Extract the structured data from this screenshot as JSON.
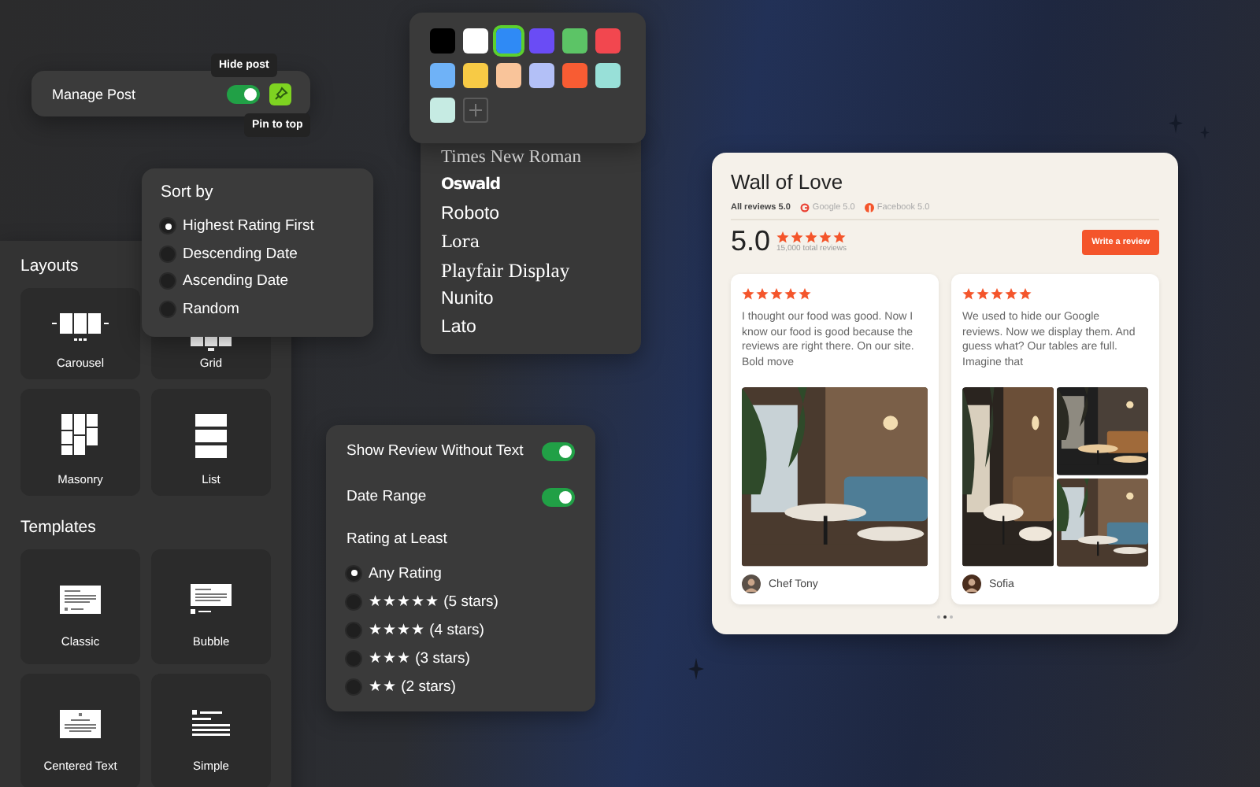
{
  "manage_post": {
    "label": "Manage Post",
    "hide_on": true,
    "pinned": true,
    "hide_tooltip": "Hide post",
    "pin_tooltip": "Pin to top"
  },
  "palette": {
    "swatches": [
      {
        "color": "#000000",
        "selected": false
      },
      {
        "color": "#ffffff",
        "selected": false
      },
      {
        "color": "#2f8af5",
        "selected": true
      },
      {
        "color": "#6a4cf5",
        "selected": false
      },
      {
        "color": "#5cc466",
        "selected": false
      },
      {
        "color": "#f2474f",
        "selected": false
      },
      {
        "color": "#6fb2f7",
        "selected": false
      },
      {
        "color": "#f7ca45",
        "selected": false
      },
      {
        "color": "#f9c49a",
        "selected": false
      },
      {
        "color": "#b3c0f7",
        "selected": false
      },
      {
        "color": "#f85c33",
        "selected": false
      },
      {
        "color": "#98e0d8",
        "selected": false
      },
      {
        "color": "#c6ebe3",
        "selected": false
      }
    ]
  },
  "fonts": [
    {
      "label": "Times New Roman",
      "kind": "times"
    },
    {
      "label": "Oswald",
      "kind": "condensed"
    },
    {
      "label": "Roboto",
      "kind": "sans"
    },
    {
      "label": "Lora",
      "kind": "serif"
    },
    {
      "label": "Playfair Display",
      "kind": "display"
    },
    {
      "label": "Nunito",
      "kind": "sans"
    },
    {
      "label": "Lato",
      "kind": "sans"
    }
  ],
  "sort": {
    "title": "Sort by",
    "options": [
      {
        "label": "Highest Rating First",
        "selected": true
      },
      {
        "label": "Descending Date",
        "selected": false
      },
      {
        "label": "Ascending Date",
        "selected": false
      },
      {
        "label": "Random",
        "selected": false
      }
    ]
  },
  "layouts": {
    "title": "Layouts",
    "items": [
      {
        "kind": "carousel",
        "label": "Carousel"
      },
      {
        "kind": "grid",
        "label": "Grid"
      },
      {
        "kind": "masonry",
        "label": "Masonry"
      },
      {
        "kind": "list",
        "label": "List"
      }
    ]
  },
  "templates": {
    "title": "Templates",
    "items": [
      {
        "kind": "classic",
        "label": "Classic"
      },
      {
        "kind": "bubble",
        "label": "Bubble"
      },
      {
        "kind": "centered",
        "label": "Centered Text"
      },
      {
        "kind": "simple",
        "label": "Simple"
      }
    ]
  },
  "filters": {
    "toggles": [
      {
        "label": "Show Review Without Text",
        "on": true
      },
      {
        "label": "Date Range",
        "on": true
      }
    ],
    "rating_title": "Rating at Least",
    "rating_options": [
      {
        "label": "Any Rating",
        "selected": true
      },
      {
        "label": "★★★★★ (5 stars)",
        "selected": false
      },
      {
        "label": "★★★★ (4 stars)",
        "selected": false
      },
      {
        "label": "★★★ (3 stars)",
        "selected": false
      },
      {
        "label": "★★ (2 stars)",
        "selected": false
      }
    ]
  },
  "widget": {
    "title": "Wall of Love",
    "sources": [
      {
        "kind": "all",
        "label": "All reviews 5.0",
        "selected": true
      },
      {
        "kind": "google",
        "label": "Google 5.0",
        "selected": false
      },
      {
        "kind": "facebook",
        "label": "Facebook 5.0",
        "selected": false
      }
    ],
    "rating": "5.0",
    "stars": 5,
    "total": "15,000 total reviews",
    "button": "Write a review",
    "reviews": [
      {
        "stars": 5,
        "text": "I thought our food was good. Now I know our food is good because the reviews are right there. On our site. Bold move",
        "photos": [
          {
            "kind": "picture"
          }
        ],
        "author": "Chef Tony"
      },
      {
        "stars": 5,
        "text": "We used to hide our Google reviews. Now we display them. And guess what? Our tables are full. Imagine that",
        "photos": [
          {
            "kind": "picture"
          },
          {
            "kind": "picture"
          },
          {
            "kind": "picture"
          }
        ],
        "author": "Sofia"
      }
    ],
    "pages": [
      {
        "selected": false
      },
      {
        "selected": true
      },
      {
        "selected": false
      }
    ]
  }
}
